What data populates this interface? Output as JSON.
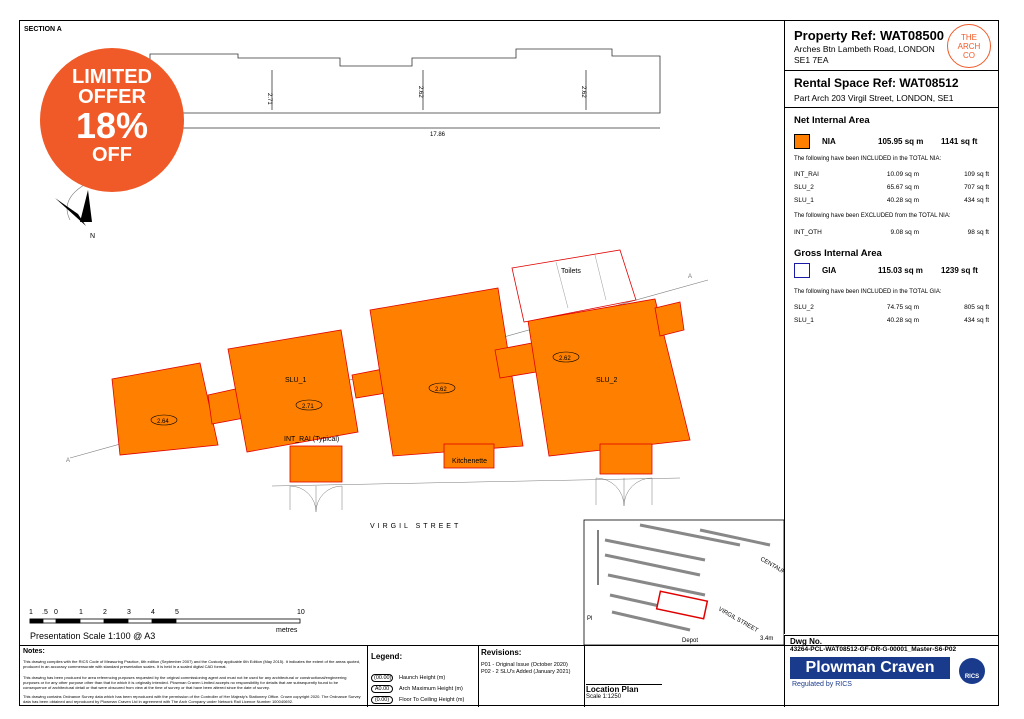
{
  "section_label": "SECTION A",
  "offer": {
    "line1": "LIMITED",
    "line2": "OFFER",
    "pct": "18%",
    "line3": "OFF",
    "color": "#f05a28"
  },
  "section_dims": {
    "d1": "2.71",
    "d2": "2.62",
    "d3": "2.62",
    "total": "17.86"
  },
  "north": "N",
  "plan": {
    "street": "VIRGIL STREET",
    "labels": {
      "slu1": "SLU_1",
      "slu2": "SLU_2",
      "int_rai": "INT_RAI (Typical)",
      "kitchenette": "Kitchenette",
      "toilets": "Toilets"
    },
    "heights": {
      "h1": "2.64",
      "h2": "2.71",
      "h3": "2.62",
      "h4": "2.62"
    },
    "fill_color": "#ff8000",
    "outline_color": "#e00000"
  },
  "scale": {
    "ticks": [
      "1",
      ".5",
      "0",
      "1",
      "2",
      "3",
      "4",
      "5",
      "10"
    ],
    "unit": "metres",
    "caption": "Presentation Scale  1:100 @ A3"
  },
  "property": {
    "ref_title": "Property Ref: WAT08500",
    "address1": "Arches Btn Lambeth Road, LONDON",
    "address2": "SE1 7EA",
    "logo": "THE ARCH CO",
    "rental_title": "Rental Space Ref: WAT08512",
    "rental_address": "Part Arch 203 Virgil Street, LONDON, SE1"
  },
  "nia": {
    "heading": "Net Internal Area",
    "label": "NIA",
    "sqm": "105.95 sq m",
    "sqft": "1141 sq ft",
    "included_text": "The following have been INCLUDED in the TOTAL NIA:",
    "included": [
      {
        "name": "INT_RAI",
        "sqm": "10.09 sq m",
        "sqft": "109 sq ft"
      },
      {
        "name": "SLU_2",
        "sqm": "65.67 sq m",
        "sqft": "707 sq ft"
      },
      {
        "name": "SLU_1",
        "sqm": "40.28 sq m",
        "sqft": "434 sq ft"
      }
    ],
    "excluded_text": "The following have been EXCLUDED from the TOTAL NIA:",
    "excluded": [
      {
        "name": "INT_OTH",
        "sqm": "9.08 sq m",
        "sqft": "98 sq ft"
      }
    ]
  },
  "gia": {
    "heading": "Gross Internal Area",
    "label": "GIA",
    "sqm": "115.03 sq m",
    "sqft": "1239 sq ft",
    "included_text": "The following have been INCLUDED in the TOTAL GIA:",
    "included": [
      {
        "name": "SLU_2",
        "sqm": "74.75 sq m",
        "sqft": "805 sq ft"
      },
      {
        "name": "SLU_1",
        "sqm": "40.28 sq m",
        "sqft": "434 sq ft"
      }
    ]
  },
  "notes": {
    "heading": "Notes:",
    "p1": "This drawing complies with the RICS Code of Measuring Practice, 6th edition (September 2007) and the Custody applicable 6th Edition (May 2015). It indicates the extent of the areas quoted, produced in an accuracy commensurate with standard presentation scales. It is held in a scaled digital CAD format.",
    "p2": "This drawing has been produced for area referencing purposes requested by the original commissioning agent and must not be used for any architectural or constructional/engineering purposes or for any other purpose other than that for which it is originally intended. Plowman Craven Limited accepts no responsibility for details that are subsequently found to be consequence of architectural detail or that were obscured from view at the time of survey or that have been altered since the date of survey.",
    "p3": "This drawing contains Ordnance Survey data which has been reproduced with the permission of the Controller of Her Majesty's Stationery Office. Crown copyright 2020. The Ordnance Survey data has been obtained and reproduced by Plowman Craven Ltd in agreement with The Arch Company under Network Rail Licence Number 100040692."
  },
  "legend": {
    "heading": "Legend:",
    "items": [
      {
        "tag": "(00.00)",
        "text": "Haunch Height (m)"
      },
      {
        "tag": "A0.00",
        "text": "Arch Maximum Height (m)"
      },
      {
        "tag": "(0.00)",
        "text": "Floor To Ceiling Height (m)"
      }
    ]
  },
  "revisions": {
    "heading": "Revisions:",
    "items": [
      "P01 - Original Issue (October 2020)",
      "P02 - 2 SLU's Added (January 2021)"
    ]
  },
  "location": {
    "title": "Location Plan",
    "scale": "Scale 1:1250",
    "labels": [
      "CENTAUR STREET",
      "VIRGIL STREET",
      "Depot",
      "3.4m",
      "Pl"
    ]
  },
  "dwg": {
    "label": "Dwg No.",
    "number": "43264-PCL-WAT08512-GF-DR-G-00001_Master-S6-P02"
  },
  "brand": {
    "name": "Plowman Craven",
    "sub": "Regulated by RICS",
    "badge": "RICS"
  }
}
